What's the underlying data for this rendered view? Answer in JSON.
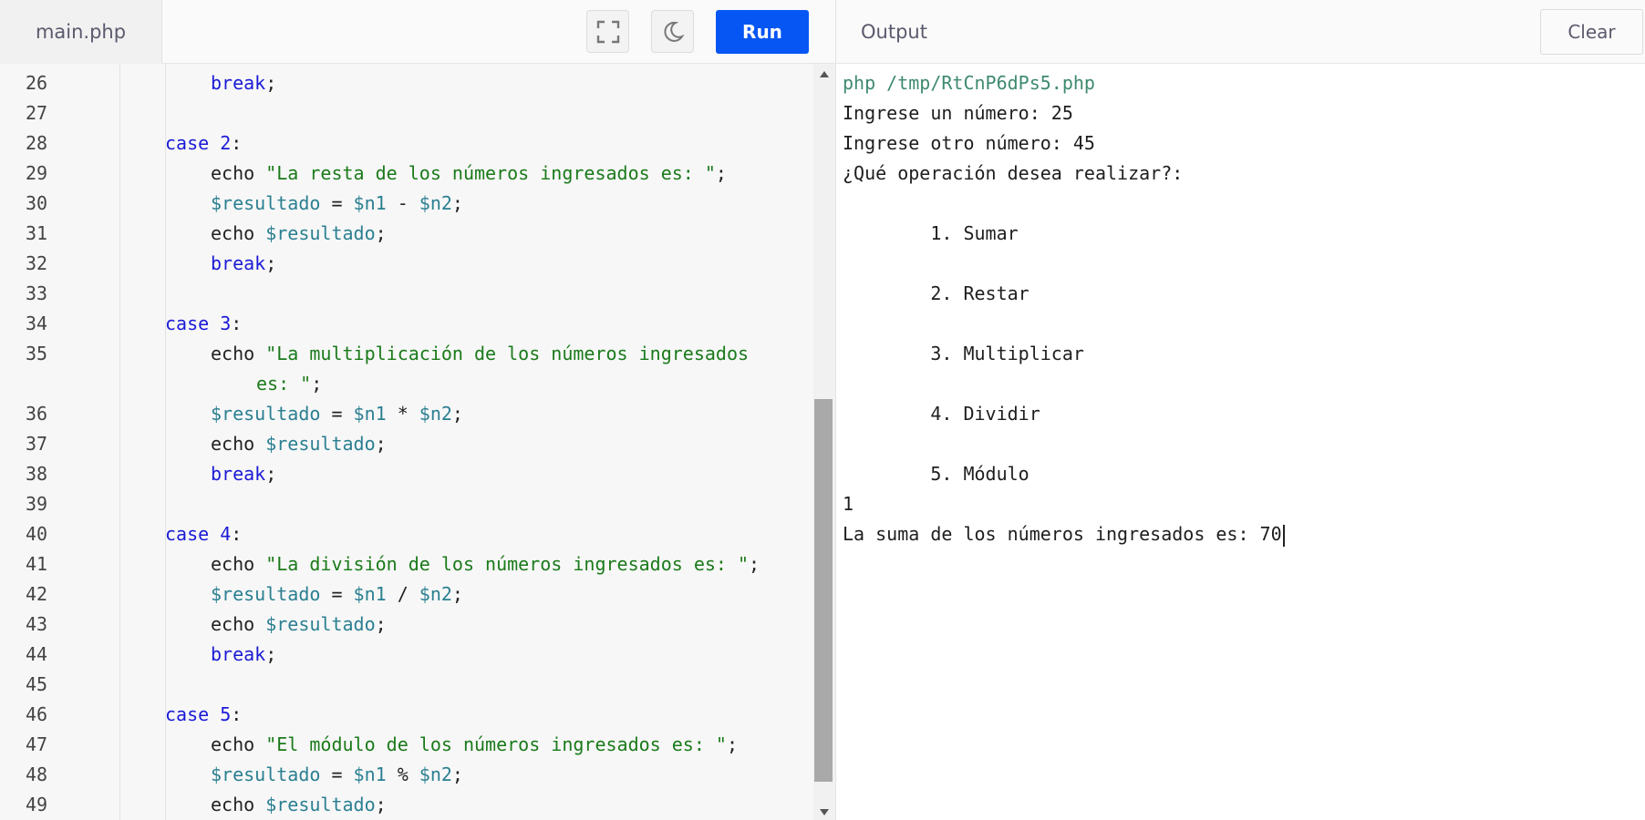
{
  "editor": {
    "file_tab": "main.php",
    "run_label": "Run",
    "fullscreen_icon": "fullscreen-icon",
    "theme_icon": "moon-icon",
    "lines": [
      {
        "num": "26",
        "indent": 2,
        "tokens": [
          {
            "t": "break",
            "c": "kw"
          },
          {
            "t": ";",
            "c": ""
          }
        ]
      },
      {
        "num": "27",
        "indent": 0,
        "tokens": []
      },
      {
        "num": "28",
        "indent": 1,
        "tokens": [
          {
            "t": "case ",
            "c": "kw"
          },
          {
            "t": "2",
            "c": "num"
          },
          {
            "t": ":",
            "c": ""
          }
        ]
      },
      {
        "num": "29",
        "indent": 2,
        "tokens": [
          {
            "t": "echo ",
            "c": ""
          },
          {
            "t": "\"La resta de los números ingresados es: \"",
            "c": "str"
          },
          {
            "t": ";",
            "c": ""
          }
        ]
      },
      {
        "num": "30",
        "indent": 2,
        "tokens": [
          {
            "t": "$resultado",
            "c": "var"
          },
          {
            "t": " = ",
            "c": ""
          },
          {
            "t": "$n1",
            "c": "var"
          },
          {
            "t": " - ",
            "c": ""
          },
          {
            "t": "$n2",
            "c": "var"
          },
          {
            "t": ";",
            "c": ""
          }
        ]
      },
      {
        "num": "31",
        "indent": 2,
        "tokens": [
          {
            "t": "echo ",
            "c": ""
          },
          {
            "t": "$resultado",
            "c": "var"
          },
          {
            "t": ";",
            "c": ""
          }
        ]
      },
      {
        "num": "32",
        "indent": 2,
        "tokens": [
          {
            "t": "break",
            "c": "kw"
          },
          {
            "t": ";",
            "c": ""
          }
        ]
      },
      {
        "num": "33",
        "indent": 0,
        "tokens": []
      },
      {
        "num": "34",
        "indent": 1,
        "tokens": [
          {
            "t": "case ",
            "c": "kw"
          },
          {
            "t": "3",
            "c": "num"
          },
          {
            "t": ":",
            "c": ""
          }
        ]
      },
      {
        "num": "35",
        "indent": 2,
        "tokens": [
          {
            "t": "echo ",
            "c": ""
          },
          {
            "t": "\"La multiplicación de los números ingresados",
            "c": "str"
          }
        ]
      },
      {
        "num": "",
        "indent": 3,
        "tokens": [
          {
            "t": "es: \"",
            "c": "str"
          },
          {
            "t": ";",
            "c": ""
          }
        ]
      },
      {
        "num": "36",
        "indent": 2,
        "tokens": [
          {
            "t": "$resultado",
            "c": "var"
          },
          {
            "t": " = ",
            "c": ""
          },
          {
            "t": "$n1",
            "c": "var"
          },
          {
            "t": " * ",
            "c": ""
          },
          {
            "t": "$n2",
            "c": "var"
          },
          {
            "t": ";",
            "c": ""
          }
        ]
      },
      {
        "num": "37",
        "indent": 2,
        "tokens": [
          {
            "t": "echo ",
            "c": ""
          },
          {
            "t": "$resultado",
            "c": "var"
          },
          {
            "t": ";",
            "c": ""
          }
        ]
      },
      {
        "num": "38",
        "indent": 2,
        "tokens": [
          {
            "t": "break",
            "c": "kw"
          },
          {
            "t": ";",
            "c": ""
          }
        ]
      },
      {
        "num": "39",
        "indent": 0,
        "tokens": []
      },
      {
        "num": "40",
        "indent": 1,
        "tokens": [
          {
            "t": "case ",
            "c": "kw"
          },
          {
            "t": "4",
            "c": "num"
          },
          {
            "t": ":",
            "c": ""
          }
        ]
      },
      {
        "num": "41",
        "indent": 2,
        "tokens": [
          {
            "t": "echo ",
            "c": ""
          },
          {
            "t": "\"La división de los números ingresados es: \"",
            "c": "str"
          },
          {
            "t": ";",
            "c": ""
          }
        ]
      },
      {
        "num": "42",
        "indent": 2,
        "tokens": [
          {
            "t": "$resultado",
            "c": "var"
          },
          {
            "t": " = ",
            "c": ""
          },
          {
            "t": "$n1",
            "c": "var"
          },
          {
            "t": " / ",
            "c": ""
          },
          {
            "t": "$n2",
            "c": "var"
          },
          {
            "t": ";",
            "c": ""
          }
        ]
      },
      {
        "num": "43",
        "indent": 2,
        "tokens": [
          {
            "t": "echo ",
            "c": ""
          },
          {
            "t": "$resultado",
            "c": "var"
          },
          {
            "t": ";",
            "c": ""
          }
        ]
      },
      {
        "num": "44",
        "indent": 2,
        "tokens": [
          {
            "t": "break",
            "c": "kw"
          },
          {
            "t": ";",
            "c": ""
          }
        ]
      },
      {
        "num": "45",
        "indent": 0,
        "tokens": []
      },
      {
        "num": "46",
        "indent": 1,
        "tokens": [
          {
            "t": "case ",
            "c": "kw"
          },
          {
            "t": "5",
            "c": "num"
          },
          {
            "t": ":",
            "c": ""
          }
        ]
      },
      {
        "num": "47",
        "indent": 2,
        "tokens": [
          {
            "t": "echo ",
            "c": ""
          },
          {
            "t": "\"El módulo de los números ingresados es: \"",
            "c": "str"
          },
          {
            "t": ";",
            "c": ""
          }
        ]
      },
      {
        "num": "48",
        "indent": 2,
        "tokens": [
          {
            "t": "$resultado",
            "c": "var"
          },
          {
            "t": " = ",
            "c": ""
          },
          {
            "t": "$n1",
            "c": "var"
          },
          {
            "t": " % ",
            "c": ""
          },
          {
            "t": "$n2",
            "c": "var"
          },
          {
            "t": ";",
            "c": ""
          }
        ]
      },
      {
        "num": "49",
        "indent": 2,
        "tokens": [
          {
            "t": "echo ",
            "c": ""
          },
          {
            "t": "$resultado",
            "c": "var"
          },
          {
            "t": ";",
            "c": ""
          }
        ]
      }
    ]
  },
  "output": {
    "title": "Output",
    "clear_label": "Clear",
    "lines": [
      {
        "text": "php /tmp/RtCnP6dPs5.php",
        "kind": "cmd"
      },
      {
        "text": "Ingrese un número: 25",
        "kind": "text"
      },
      {
        "text": "Ingrese otro número: 45",
        "kind": "text"
      },
      {
        "text": "¿Qué operación desea realizar?:",
        "kind": "text"
      },
      {
        "text": "",
        "kind": "text"
      },
      {
        "text": "        1. Sumar",
        "kind": "text"
      },
      {
        "text": "",
        "kind": "text"
      },
      {
        "text": "        2. Restar",
        "kind": "text"
      },
      {
        "text": "",
        "kind": "text"
      },
      {
        "text": "        3. Multiplicar",
        "kind": "text"
      },
      {
        "text": "",
        "kind": "text"
      },
      {
        "text": "        4. Dividir",
        "kind": "text"
      },
      {
        "text": "",
        "kind": "text"
      },
      {
        "text": "        5. Módulo",
        "kind": "text"
      },
      {
        "text": "1",
        "kind": "text"
      },
      {
        "text": "La suma de los números ingresados es: 70",
        "kind": "last"
      }
    ]
  }
}
